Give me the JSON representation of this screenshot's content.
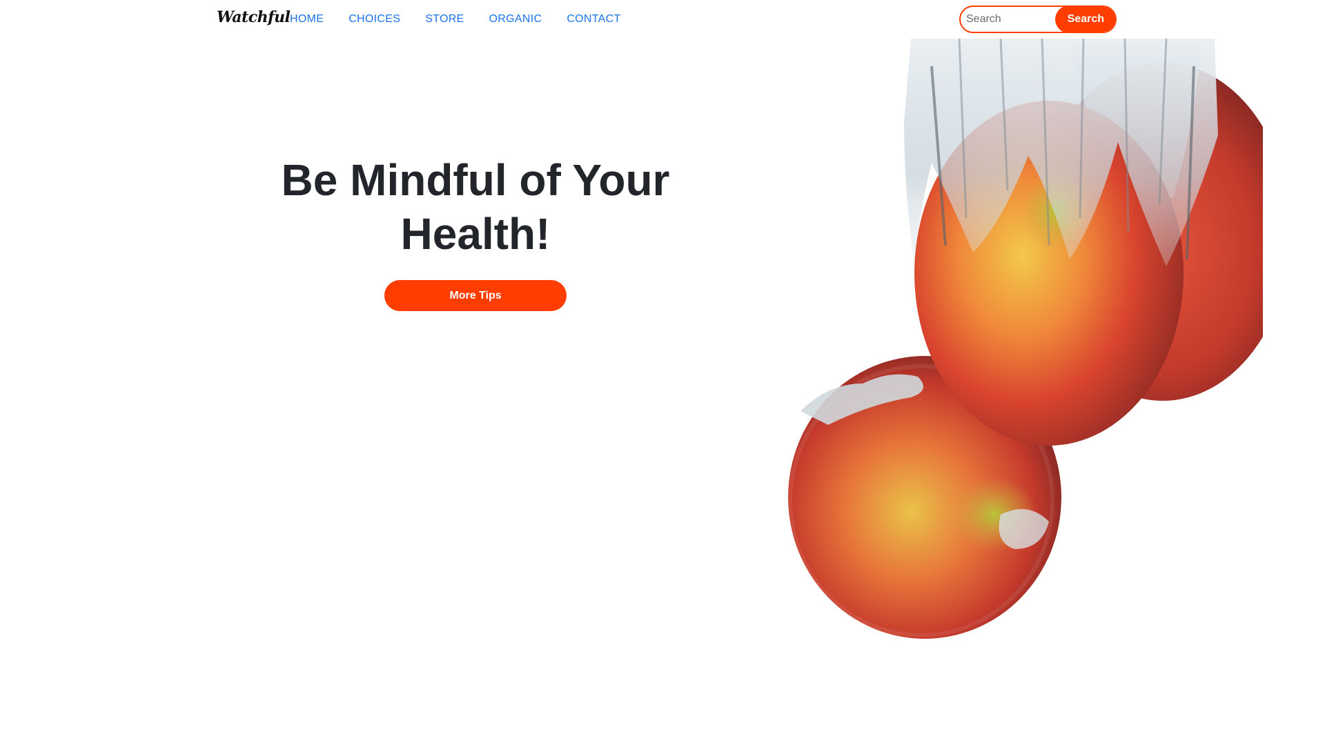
{
  "brand": {
    "name": "Watchful"
  },
  "nav": {
    "links": [
      {
        "label": "HOME"
      },
      {
        "label": "CHOICES"
      },
      {
        "label": "STORE"
      },
      {
        "label": "ORGANIC"
      },
      {
        "label": "CONTACT"
      }
    ]
  },
  "search": {
    "placeholder": "Search",
    "value": "",
    "button_label": "Search"
  },
  "hero": {
    "title": "Be Mindful of Your Health!",
    "cta_label": "More Tips",
    "image": "apples-splashing-in-water"
  },
  "colors": {
    "accent": "#ff3d00",
    "link": "#1a73e8",
    "heading": "#222529",
    "background": "#ffffff"
  }
}
